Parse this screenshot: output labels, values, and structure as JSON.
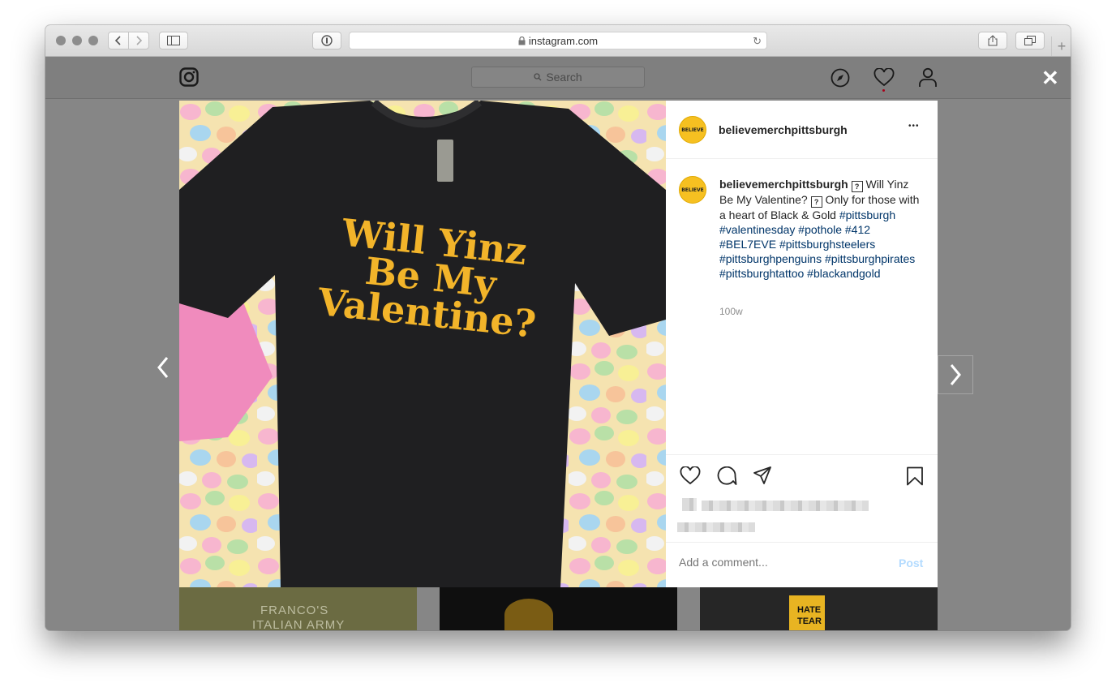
{
  "browser": {
    "url": "instagram.com",
    "new_tab": "+"
  },
  "instagram": {
    "search_placeholder": "Search",
    "close": "✕"
  },
  "post": {
    "shirt_text": [
      "Will Yinz",
      "Be My",
      "Valentine?"
    ],
    "username": "believemerchpittsburgh",
    "avatar_text": "BELIEVE",
    "more": "•••",
    "caption_text_1": "Will Yinz Be My Valentine?",
    "caption_text_2": "Only for those with a heart of Black & Gold",
    "caption_emoji": "?",
    "hashtags": "#pittsburgh #valentinesday #pothole #412 #BEL7EVE #pittsburghsteelers #pittsburghpenguins #pittsburghpirates #pittsburghtattoo #blackandgold",
    "time": "100w",
    "comment_placeholder": "Add a comment...",
    "post_button": "Post"
  },
  "background": {
    "thumb_text_1": "FRANCO'S",
    "thumb_text_2": "ITALIAN ARMY",
    "thumb_text_3": "HATE",
    "thumb_text_4": "TEAR"
  }
}
